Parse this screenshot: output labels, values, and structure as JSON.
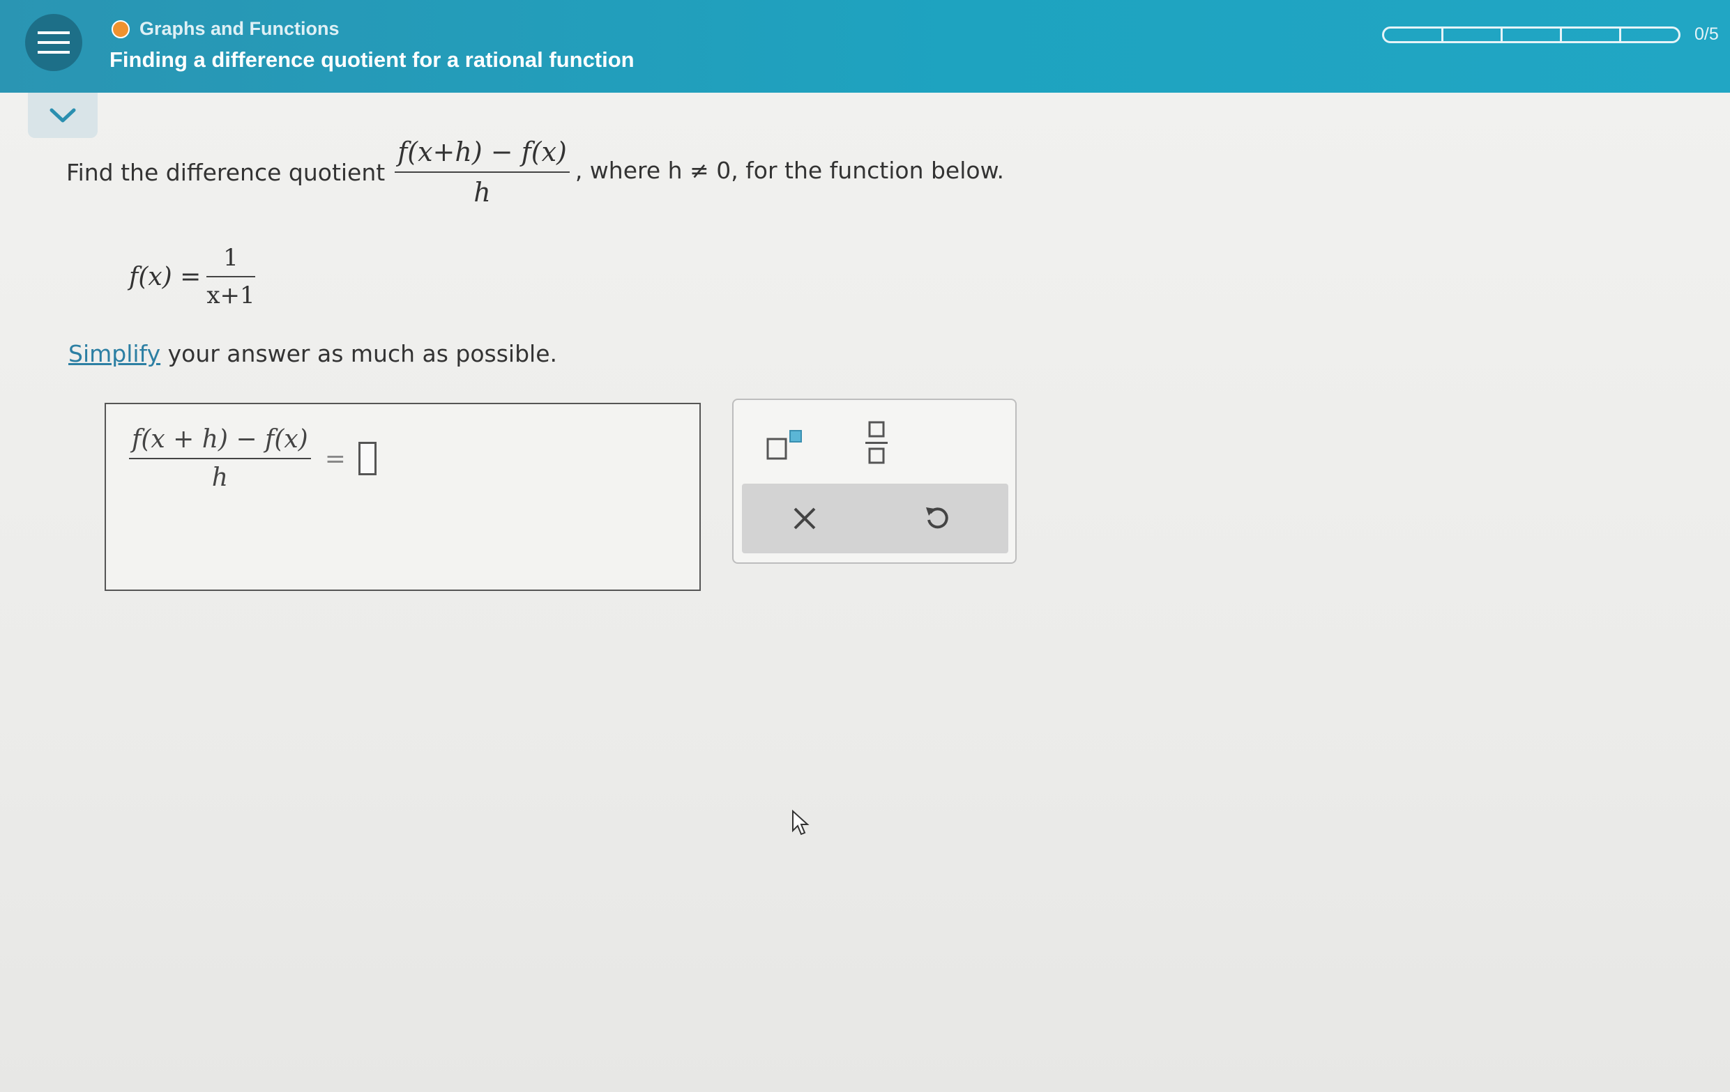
{
  "header": {
    "topic": "Graphs and Functions",
    "title": "Finding a difference quotient for a rational function",
    "progress": {
      "completed": 0,
      "total": 5,
      "label": "0/5"
    }
  },
  "question": {
    "prompt_start": "Find the difference quotient",
    "quotient_numerator": "f(x+h) − f(x)",
    "quotient_denominator": "h",
    "prompt_end": ", where h ≠ 0, for the function below.",
    "function_lhs": "f(x) =",
    "function_numerator": "1",
    "function_denominator": "x+1",
    "instruction_link": "Simplify",
    "instruction_rest": " your answer as much as possible."
  },
  "answer": {
    "lhs_numerator": "f(x + h) − f(x)",
    "lhs_denominator": "h",
    "equals": "=",
    "value": ""
  },
  "toolbar": {
    "buttons": [
      "superscript-icon",
      "fraction-icon",
      "clear-icon",
      "undo-icon"
    ]
  },
  "colors": {
    "header_bg": "#1ea3c0",
    "topic_dot": "#f0922f",
    "link": "#2c7fa3"
  }
}
